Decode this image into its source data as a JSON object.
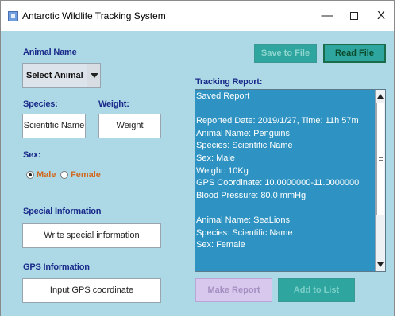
{
  "window": {
    "title": "Antarctic Wildlife Tracking System",
    "controls": {
      "minimize": "—",
      "close": "X"
    }
  },
  "form": {
    "animal_name_label": "Animal Name",
    "animal_select_value": "Select Animal",
    "species_label": "Species:",
    "species_value": "Scientific Name",
    "weight_label": "Weight:",
    "weight_value": "Weight",
    "sex_label": "Sex:",
    "sex_options": [
      {
        "label": "Male",
        "selected": true
      },
      {
        "label": "Female",
        "selected": false
      }
    ],
    "special_info_label": "Special Information",
    "special_info_value": "Write special information",
    "gps_label": "GPS Information",
    "gps_value": "Input GPS coordinate"
  },
  "actions": {
    "save_to_file": "Save to File",
    "read_file": "Read File",
    "make_report": "Make Report",
    "add_to_list": "Add to List"
  },
  "report": {
    "label": "Tracking Report:",
    "lines": [
      "Saved Report",
      "",
      "Reported Date: 2019/1/27, Time: 11h 57m",
      "Animal Name: Penguins",
      "Species: Scientific Name",
      "Sex: Male",
      "Weight: 10Kg",
      "GPS Coordinate: 10.0000000-11.0000000",
      "Blood Pressure: 80.0 mmHg",
      "",
      "Animal Name: SeaLions",
      "Species: Scientific Name",
      "Sex: Female"
    ]
  },
  "colors": {
    "background": "#add8e6",
    "label_text": "#1a2a8a",
    "report_background": "#2e93c2",
    "teal_button": "#2ea59e",
    "radio_text": "#d2691e"
  }
}
